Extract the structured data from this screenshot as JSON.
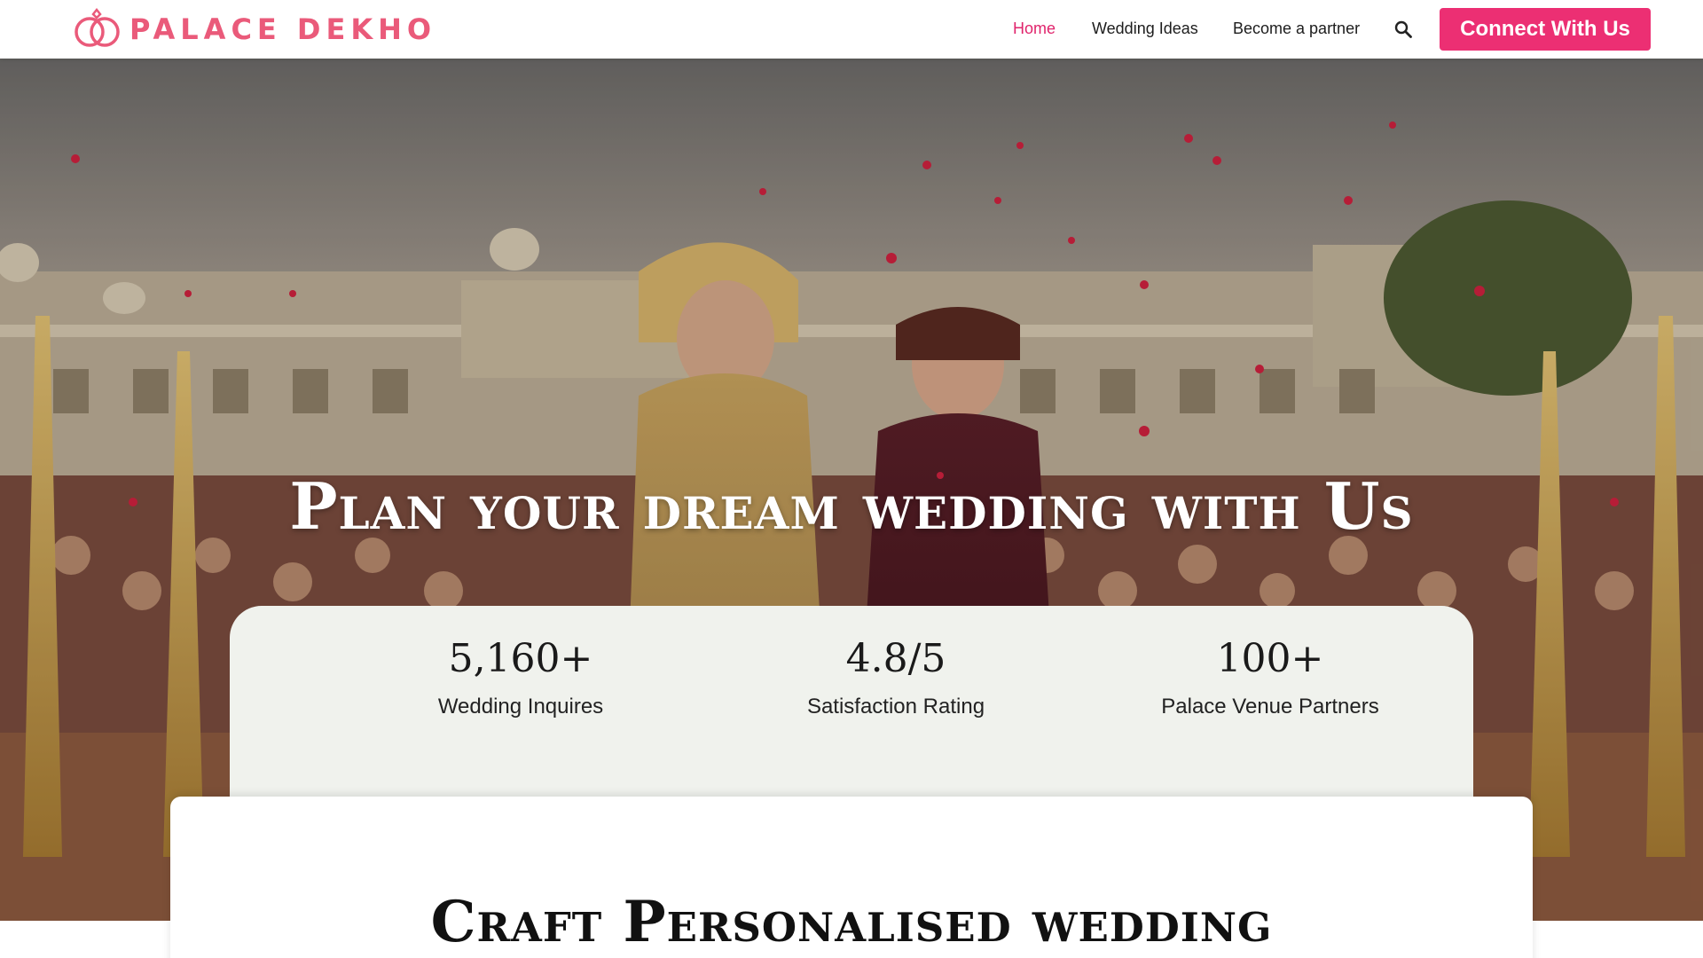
{
  "brand": {
    "name": "PALACE DEKHO",
    "accent_color": "#ea5a7a"
  },
  "nav": {
    "items": [
      {
        "label": "Home",
        "active": true
      },
      {
        "label": "Wedding Ideas",
        "active": false
      },
      {
        "label": "Become a partner",
        "active": false
      }
    ],
    "search_icon": "search-icon",
    "cta_label": "Connect With Us",
    "cta_color": "#ec2f73",
    "active_color": "#e0246c"
  },
  "hero": {
    "title": "Plan your dream wedding with Us"
  },
  "stats": [
    {
      "value": "5,160+",
      "label": "Wedding Inquires"
    },
    {
      "value": "4.8/5",
      "label": "Satisfaction Rating"
    },
    {
      "value": "100+",
      "label": "Palace Venue Partners"
    }
  ],
  "craft": {
    "title": "Craft Personalised wedding"
  }
}
